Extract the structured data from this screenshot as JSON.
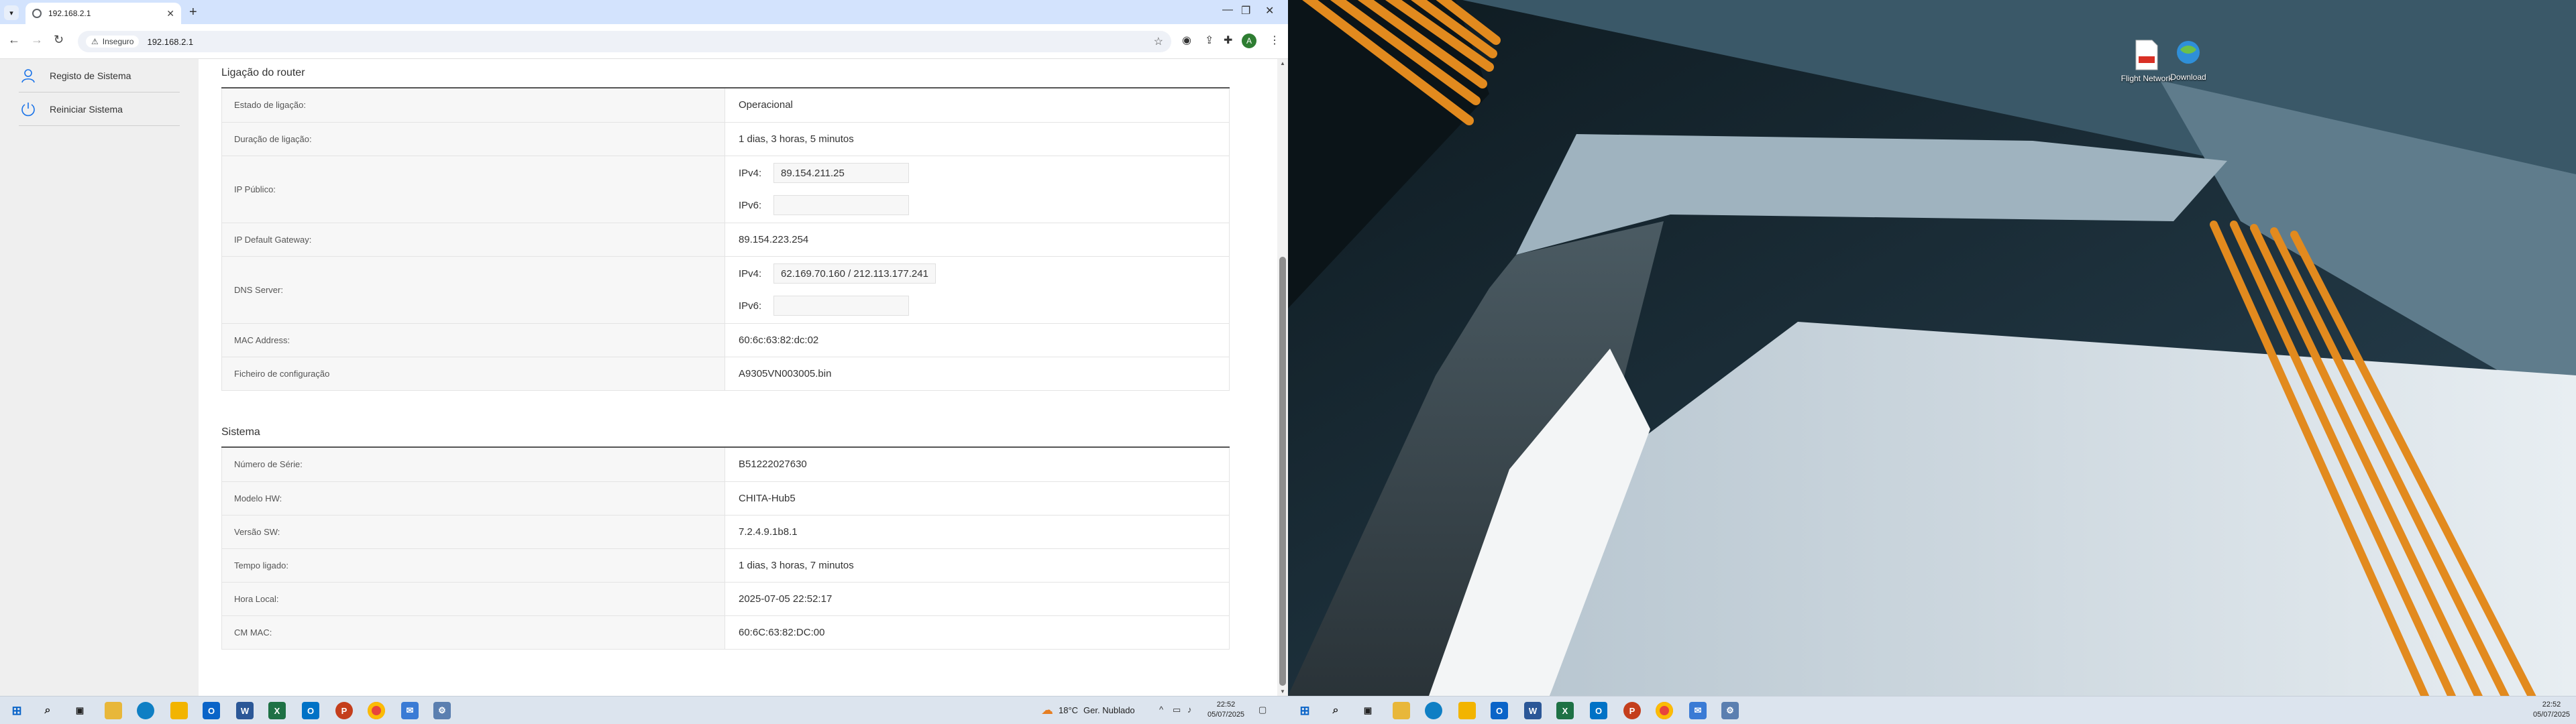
{
  "browser": {
    "tab_title": "192.168.2.1",
    "security_label": "Inseguro",
    "url": "192.168.2.1",
    "profile_initial": "A"
  },
  "sidebar": {
    "items": [
      {
        "label": "Registo de Sistema",
        "icon": "user-icon"
      },
      {
        "label": "Reiniciar Sistema",
        "icon": "power-icon"
      }
    ]
  },
  "router_section": {
    "title": "Ligação do router",
    "rows": [
      {
        "key": "Estado de ligação:",
        "value": "Operacional"
      },
      {
        "key": "Duração de ligação:",
        "value": "1 dias, 3 horas, 5 minutos"
      },
      {
        "key": "IP Público:",
        "ipv4_label": "IPv4:",
        "ipv4": "89.154.211.25",
        "ipv6_label": "IPv6:",
        "ipv6": ""
      },
      {
        "key": "IP Default Gateway:",
        "value": "89.154.223.254"
      },
      {
        "key": "DNS Server:",
        "ipv4_label": "IPv4:",
        "ipv4": "62.169.70.160 / 212.113.177.241",
        "ipv6_label": "IPv6:",
        "ipv6": ""
      },
      {
        "key": "MAC Address:",
        "value": "60:6c:63:82:dc:02"
      },
      {
        "key": "Ficheiro de configuração",
        "value": "A9305VN003005.bin"
      }
    ]
  },
  "system_section": {
    "title": "Sistema",
    "rows": [
      {
        "key": "Número de Série:",
        "value": "B51222027630"
      },
      {
        "key": "Modelo HW:",
        "value": "CHITA-Hub5"
      },
      {
        "key": "Versão SW:",
        "value": "7.2.4.9.1b8.1"
      },
      {
        "key": "Tempo ligado:",
        "value": "1 dias, 3 horas, 7 minutos"
      },
      {
        "key": "Hora Local:",
        "value": "2025-07-05 22:52:17"
      },
      {
        "key": "CM MAC:",
        "value": "60:6C:63:82:DC:00"
      }
    ]
  },
  "taskbar_left": {
    "weather_temp": "18°C",
    "weather_desc": "Ger. Nublado",
    "time": "22:52",
    "date": "05/07/2025"
  },
  "taskbar_right": {
    "time": "22:52",
    "date": "05/07/2025"
  },
  "desktop": {
    "icons": [
      {
        "label": "Flight Network",
        "type": "pdf-file-icon",
        "badge": "PDF"
      },
      {
        "label": "Download",
        "type": "globe-shortcut-icon"
      }
    ]
  },
  "colors": {
    "tabstrip": "#d3e3fd",
    "sidebar_bg": "#efefef",
    "accent": "#1a73e8",
    "taskbar": "#dce4ee"
  }
}
